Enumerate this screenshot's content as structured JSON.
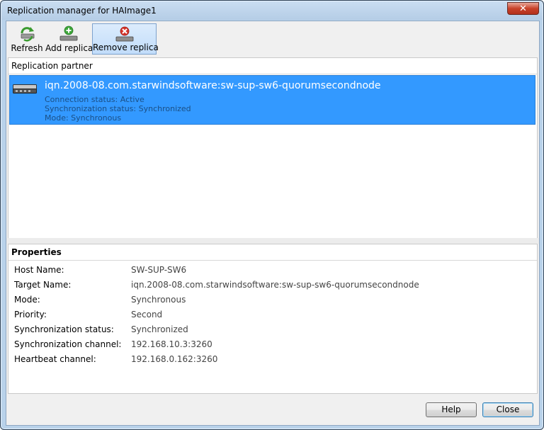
{
  "window": {
    "title": "Replication manager for HAImage1"
  },
  "toolbar": {
    "refresh_label": "Refresh",
    "add_label": "Add replica",
    "remove_label": "Remove replica"
  },
  "partners": {
    "header": "Replication partner",
    "items": [
      {
        "name": "iqn.2008-08.com.starwindsoftware:sw-sup-sw6-quorumsecondnode",
        "connection": "Connection status: Active",
        "sync": "Synchronization status: Synchronized",
        "mode": "Mode: Synchronous"
      }
    ]
  },
  "properties": {
    "header": "Properties",
    "rows": [
      {
        "key": "Host Name:",
        "value": "SW-SUP-SW6"
      },
      {
        "key": "Target Name:",
        "value": "iqn.2008-08.com.starwindsoftware:sw-sup-sw6-quorumsecondnode"
      },
      {
        "key": "Mode:",
        "value": "Synchronous"
      },
      {
        "key": "Priority:",
        "value": "Second"
      },
      {
        "key": "Synchronization status:",
        "value": "Synchronized"
      },
      {
        "key": "Synchronization channel:",
        "value": "192.168.10.3:3260"
      },
      {
        "key": "Heartbeat channel:",
        "value": "192.168.0.162:3260"
      }
    ]
  },
  "buttons": {
    "help": "Help",
    "close": "Close"
  },
  "icons": {
    "refresh": "refresh-icon",
    "add": "add-replica-icon",
    "remove": "remove-replica-icon",
    "server": "server-icon",
    "close": "close-icon"
  },
  "colors": {
    "selection": "#3399ff",
    "accent_red": "#c8422a"
  }
}
